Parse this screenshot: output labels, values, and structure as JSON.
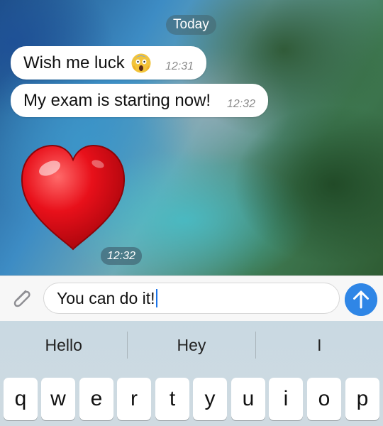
{
  "chat": {
    "date_separator": "Today",
    "messages": [
      {
        "text": "Wish me luck",
        "emoji": "screaming-face",
        "time": "12:31"
      },
      {
        "text": "My exam is starting now!",
        "time": "12:32"
      }
    ],
    "sticker": {
      "kind": "red-heart",
      "time": "12:32"
    }
  },
  "composer": {
    "attach_icon": "paperclip-icon",
    "draft_text": "You can do it!",
    "send_icon": "arrow-up-icon",
    "send_color": "#2f86e6"
  },
  "keyboard": {
    "suggestions": [
      "Hello",
      "Hey",
      "I"
    ],
    "keys": [
      "q",
      "w",
      "e",
      "r",
      "t",
      "y",
      "u",
      "i",
      "o",
      "p"
    ]
  }
}
